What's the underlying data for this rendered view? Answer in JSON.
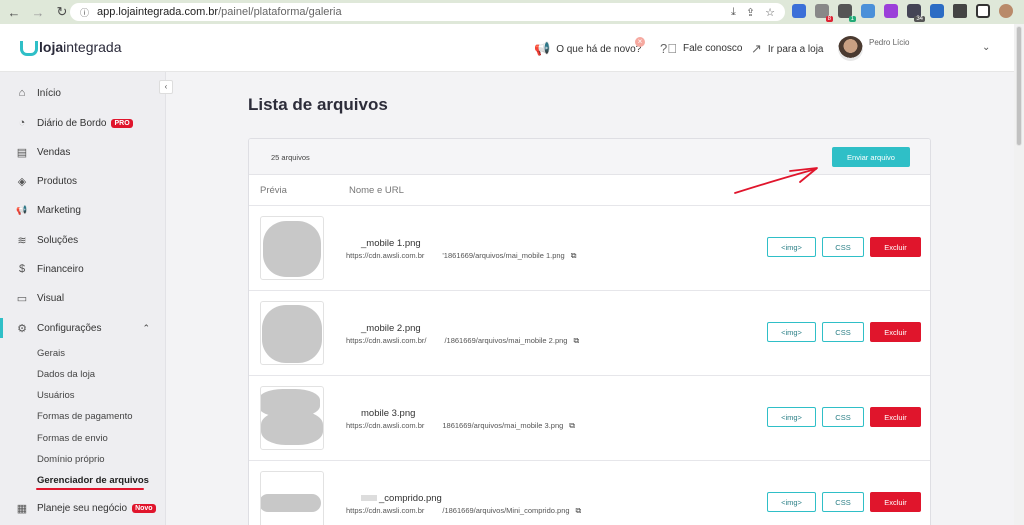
{
  "browser": {
    "back": "←",
    "forward": "→",
    "reload": "↻",
    "lock": "ⓘ",
    "url_host": "app.lojaintegrada.com.br",
    "url_path": "/painel/plataforma/galeria",
    "ext_badges": [
      "8",
      "1",
      "34"
    ]
  },
  "header": {
    "logo_bold": "loja",
    "logo_light": "integrada",
    "news_label": "O que há de novo?",
    "contact_label": "Fale conosco",
    "store_label": "Ir para a loja",
    "user_name": "Pedro Lício",
    "notif_glyph": "×"
  },
  "sidebar": {
    "items": [
      {
        "label": "Início",
        "icon": "⌂"
      },
      {
        "label": "Diário de Bordo",
        "icon": "◔",
        "badge": "PRO"
      },
      {
        "label": "Vendas",
        "icon": "▤"
      },
      {
        "label": "Produtos",
        "icon": "◈"
      },
      {
        "label": "Marketing",
        "icon": "📢"
      },
      {
        "label": "Soluções",
        "icon": "≋"
      },
      {
        "label": "Financeiro",
        "icon": "$"
      },
      {
        "label": "Visual",
        "icon": "▭"
      },
      {
        "label": "Configurações",
        "icon": "⚙"
      },
      {
        "label": "Planeje seu negócio",
        "icon": "▦",
        "badge": "Novo"
      }
    ],
    "sub_items": [
      "Gerais",
      "Dados da loja",
      "Usuários",
      "Formas de pagamento",
      "Formas de envio",
      "Domínio próprio",
      "Gerenciador de arquivos"
    ]
  },
  "main": {
    "title": "Lista de arquivos",
    "file_count": "25 arquivos",
    "upload_label": "Enviar arquivo",
    "col_preview": "Prévia",
    "col_name": "Nome e URL",
    "files": [
      {
        "name": "_mobile 1.png",
        "url_a": "https://cdn.awsli.com.br",
        "url_b": "'1861669/arquivos/mai_mobile 1.png"
      },
      {
        "name": "_mobile 2.png",
        "url_a": "https://cdn.awsli.com.br/",
        "url_b": "/1861669/arquivos/mai_mobile 2.png"
      },
      {
        "name": "mobile 3.png",
        "url_a": "https://cdn.awsli.com.br",
        "url_b": "1861669/arquivos/mai_mobile 3.png"
      },
      {
        "name": "_comprido.png",
        "url_a": "https://cdn.awsli.com.br",
        "url_b": "/1861669/arquivos/Mini_comprido.png"
      }
    ],
    "btn_img": "<img>",
    "btn_css": "CSS",
    "btn_delete": "Excluir",
    "copy_icon": "⧉"
  }
}
